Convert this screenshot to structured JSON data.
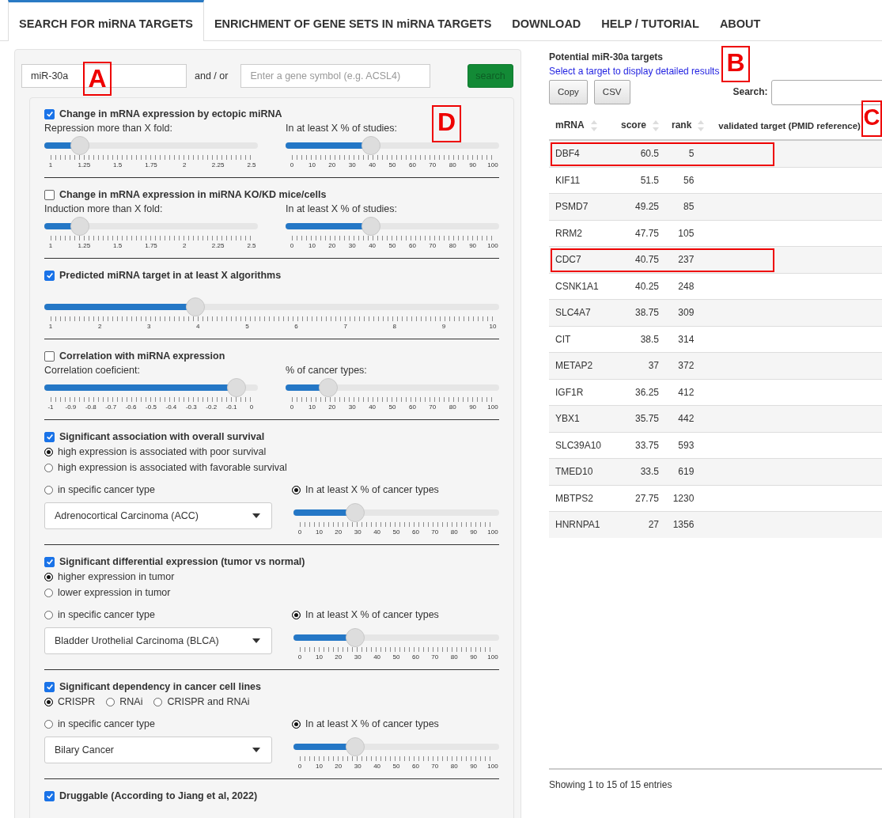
{
  "tabs": [
    {
      "label": "SEARCH FOR miRNA TARGETS",
      "selected": true
    },
    {
      "label": "ENRICHMENT OF GENE SETS IN miRNA TARGETS",
      "selected": false
    },
    {
      "label": "DOWNLOAD",
      "selected": false
    },
    {
      "label": "HELP / TUTORIAL",
      "selected": false
    },
    {
      "label": "ABOUT",
      "selected": false
    }
  ],
  "query": {
    "mirna_value": "miR-30a",
    "joiner": "and / or",
    "gene_placeholder": "Enter a gene symbol (e.g. ACSL4)",
    "button": "search"
  },
  "filters": [
    {
      "kind": "two_sliders",
      "checked": true,
      "title": "Change in mRNA expression by ectopic miRNA",
      "sliders": [
        {
          "label": "Repression more than X fold:",
          "level": 0.167,
          "ticks": [
            "1",
            "1.25",
            "1.5",
            "1.75",
            "2",
            "2.25",
            "2.5"
          ]
        },
        {
          "label": "In at least X % of studies:",
          "level": 0.4,
          "ticks": [
            "0",
            "10",
            "20",
            "30",
            "40",
            "50",
            "60",
            "70",
            "80",
            "90",
            "100"
          ]
        }
      ]
    },
    {
      "kind": "two_sliders",
      "checked": false,
      "title": "Change in mRNA expression in miRNA KO/KD mice/cells",
      "sliders": [
        {
          "label": "Induction more than X fold:",
          "level": 0.167,
          "ticks": [
            "1",
            "1.25",
            "1.5",
            "1.75",
            "2",
            "2.25",
            "2.5"
          ]
        },
        {
          "label": "In at least X % of studies:",
          "level": 0.4,
          "ticks": [
            "0",
            "10",
            "20",
            "30",
            "40",
            "50",
            "60",
            "70",
            "80",
            "90",
            "100"
          ]
        }
      ]
    },
    {
      "kind": "one_slider",
      "checked": true,
      "title": "Predicted miRNA target in at least X algorithms",
      "sliders": [
        {
          "level": 0.333,
          "ticks": [
            "1",
            "2",
            "3",
            "4",
            "5",
            "6",
            "7",
            "8",
            "9",
            "10"
          ]
        }
      ]
    },
    {
      "kind": "two_sliders",
      "checked": false,
      "title": "Correlation with miRNA expression",
      "sliders": [
        {
          "label": "Correlation coeficient:",
          "level": 0.9,
          "ticks": [
            "-1",
            "-0.9",
            "-0.8",
            "-0.7",
            "-0.6",
            "-0.5",
            "-0.4",
            "-0.3",
            "-0.2",
            "-0.1",
            "0"
          ]
        },
        {
          "label": "% of cancer types:",
          "level": 0.2,
          "ticks": [
            "0",
            "10",
            "20",
            "30",
            "40",
            "50",
            "60",
            "70",
            "80",
            "90",
            "100"
          ]
        }
      ]
    },
    {
      "kind": "cancer",
      "checked": true,
      "title": "Significant association with overall survival",
      "directions": [
        {
          "label": "high expression is associated with poor survival",
          "selected": true
        },
        {
          "label": "high expression is associated with favorable survival",
          "selected": false
        }
      ],
      "scope": [
        {
          "label": "in specific cancer type",
          "selected": false
        },
        {
          "label": "In at least X % of cancer types",
          "selected": true
        }
      ],
      "cancer_type": "Adrenocortical Carcinoma (ACC)",
      "slider": {
        "level": 0.3,
        "ticks": [
          "0",
          "10",
          "20",
          "30",
          "40",
          "50",
          "60",
          "70",
          "80",
          "90",
          "100"
        ]
      }
    },
    {
      "kind": "cancer",
      "checked": true,
      "title": "Significant differential expression (tumor vs normal)",
      "directions": [
        {
          "label": "higher expression in tumor",
          "selected": true
        },
        {
          "label": "lower expression in tumor",
          "selected": false
        }
      ],
      "scope": [
        {
          "label": "in specific cancer type",
          "selected": false
        },
        {
          "label": "In at least X % of cancer types",
          "selected": true
        }
      ],
      "cancer_type": "Bladder Urothelial Carcinoma (BLCA)",
      "slider": {
        "level": 0.3,
        "ticks": [
          "0",
          "10",
          "20",
          "30",
          "40",
          "50",
          "60",
          "70",
          "80",
          "90",
          "100"
        ]
      }
    },
    {
      "kind": "cancer_row",
      "checked": true,
      "title": "Significant dependency in cancer cell lines",
      "directions": [
        {
          "label": "CRISPR",
          "selected": true
        },
        {
          "label": "RNAi",
          "selected": false
        },
        {
          "label": "CRISPR and RNAi",
          "selected": false
        }
      ],
      "scope": [
        {
          "label": "in specific cancer type",
          "selected": false
        },
        {
          "label": "In at least X % of cancer types",
          "selected": true
        }
      ],
      "cancer_type": "Bilary Cancer",
      "slider": {
        "level": 0.3,
        "ticks": [
          "0",
          "10",
          "20",
          "30",
          "40",
          "50",
          "60",
          "70",
          "80",
          "90",
          "100"
        ]
      }
    },
    {
      "kind": "title_only",
      "checked": true,
      "title": "Druggable (According to Jiang et al, 2022)"
    }
  ],
  "results": {
    "title": "Potential miR-30a targets",
    "hint": "Select a target to display detailed results",
    "buttons": [
      "Copy",
      "CSV"
    ],
    "search_label": "Search:",
    "columns": [
      {
        "label": "mRNA",
        "sortable": true
      },
      {
        "label": "score",
        "sortable": true
      },
      {
        "label": "rank",
        "sortable": true
      },
      {
        "label": "validated target (PMID reference)",
        "sortable": false
      }
    ],
    "rows": [
      {
        "cells": [
          "DBF4",
          "60.5",
          "5"
        ],
        "highlighted": true
      },
      {
        "cells": [
          "KIF11",
          "51.5",
          "56"
        ],
        "highlighted": false
      },
      {
        "cells": [
          "PSMD7",
          "49.25",
          "85"
        ],
        "highlighted": false
      },
      {
        "cells": [
          "RRM2",
          "47.75",
          "105"
        ],
        "highlighted": false
      },
      {
        "cells": [
          "CDC7",
          "40.75",
          "237"
        ],
        "highlighted": true
      },
      {
        "cells": [
          "CSNK1A1",
          "40.25",
          "248"
        ],
        "highlighted": false
      },
      {
        "cells": [
          "SLC4A7",
          "38.75",
          "309"
        ],
        "highlighted": false
      },
      {
        "cells": [
          "CIT",
          "38.5",
          "314"
        ],
        "highlighted": false
      },
      {
        "cells": [
          "METAP2",
          "37",
          "372"
        ],
        "highlighted": false
      },
      {
        "cells": [
          "IGF1R",
          "36.25",
          "412"
        ],
        "highlighted": false
      },
      {
        "cells": [
          "YBX1",
          "35.75",
          "442"
        ],
        "highlighted": false
      },
      {
        "cells": [
          "SLC39A10",
          "33.75",
          "593"
        ],
        "highlighted": false
      },
      {
        "cells": [
          "TMED10",
          "33.5",
          "619"
        ],
        "highlighted": false
      },
      {
        "cells": [
          "MBTPS2",
          "27.75",
          "1230"
        ],
        "highlighted": false
      },
      {
        "cells": [
          "HNRNPA1",
          "27",
          "1356"
        ],
        "highlighted": false
      }
    ],
    "footer": "Showing 1 to 15 of 15 entries"
  },
  "annotations": [
    {
      "label": "A"
    },
    {
      "label": "B"
    },
    {
      "label": "C"
    },
    {
      "label": "D"
    }
  ]
}
